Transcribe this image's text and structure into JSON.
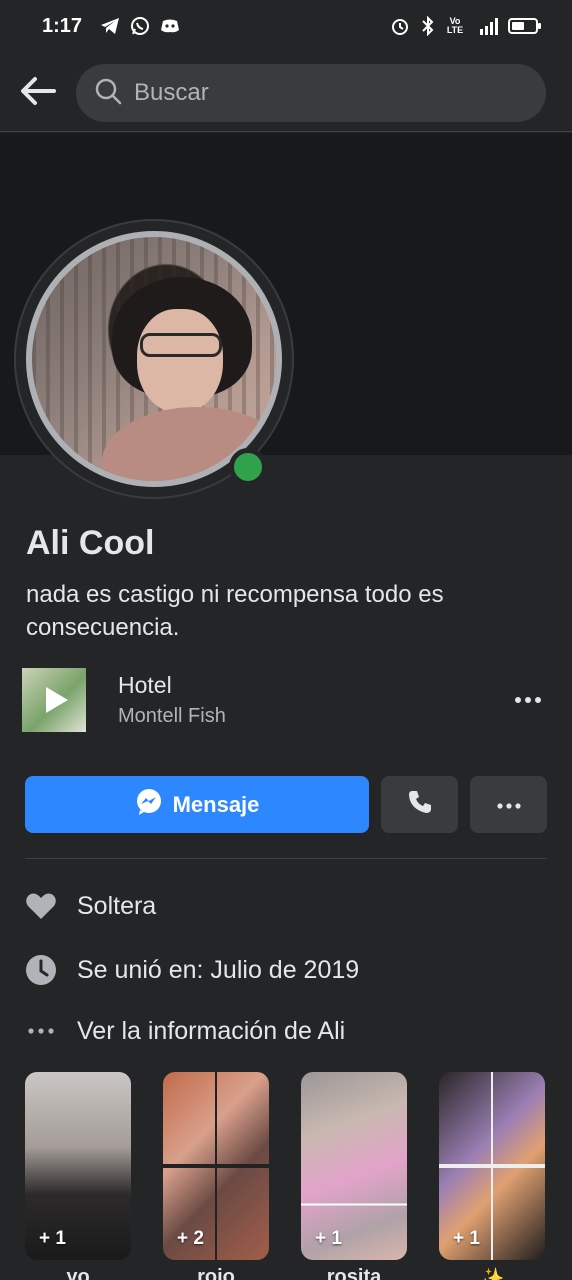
{
  "status_bar": {
    "time": "1:17",
    "left_icons": [
      "telegram-icon",
      "whatsapp-icon",
      "discord-icon"
    ],
    "right_icons": [
      "alarm-icon",
      "bluetooth-icon",
      "volte-icon",
      "signal-4g-icon",
      "battery-icon"
    ],
    "volte_label": "Vo\nLTE",
    "network_label": "4G"
  },
  "search": {
    "placeholder": "Buscar"
  },
  "profile": {
    "name": "Ali Cool",
    "bio": "nada es castigo ni recompensa todo es consecuencia.",
    "online": true
  },
  "song": {
    "title": "Hotel",
    "artist": "Montell Fish"
  },
  "actions": {
    "message_label": "Mensaje"
  },
  "info": [
    {
      "icon": "heart-icon",
      "text": "Soltera"
    },
    {
      "icon": "clock-icon",
      "text": "Se unió en: Julio de 2019"
    },
    {
      "icon": "more-dots-icon",
      "text": "Ver la información de Ali"
    }
  ],
  "highlights": [
    {
      "count": "+ 1",
      "label": "yo"
    },
    {
      "count": "+ 2",
      "label": "rojo"
    },
    {
      "count": "+ 1",
      "label": "rosita"
    },
    {
      "count": "+ 1",
      "label": "✨"
    }
  ],
  "colors": {
    "background": "#242526",
    "cover": "#18191a",
    "accent_blue": "#2d88ff",
    "online_green": "#31a24c",
    "secondary_button": "#3a3b3c"
  }
}
